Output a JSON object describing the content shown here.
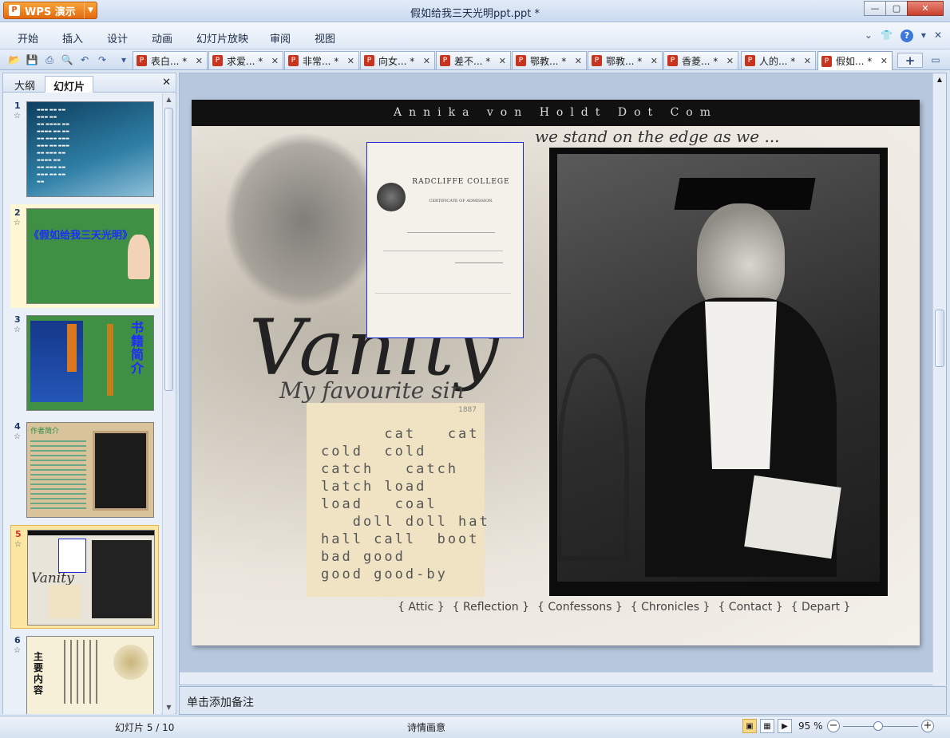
{
  "app": {
    "brand": "WPS 演示",
    "window_title": "假如给我三天光明ppt.ppt *"
  },
  "menu": {
    "items": [
      "开始",
      "插入",
      "设计",
      "动画",
      "幻灯片放映",
      "审阅",
      "视图"
    ]
  },
  "tabs": [
    {
      "label": "表白... *"
    },
    {
      "label": "求爱... *"
    },
    {
      "label": "非常... *"
    },
    {
      "label": "向女... *"
    },
    {
      "label": "差不... *"
    },
    {
      "label": "鄂教... *"
    },
    {
      "label": "鄂教... *"
    },
    {
      "label": "香菱... *"
    },
    {
      "label": "人的... *"
    },
    {
      "label": "假如... *"
    }
  ],
  "left_panel": {
    "tabs": [
      "大纲",
      "幻灯片"
    ],
    "active_tab": "幻灯片",
    "slides": [
      {
        "num": "1",
        "text": ""
      },
      {
        "num": "2",
        "text": "《假如给我三天光明》"
      },
      {
        "num": "3",
        "text": "书籍简介"
      },
      {
        "num": "4",
        "text": "作者简介"
      },
      {
        "num": "5",
        "text": ""
      },
      {
        "num": "6",
        "text": "主要内容"
      }
    ],
    "selected_slide": 5
  },
  "slide": {
    "site_header": "Annika von Holdt Dot Com",
    "tagline": "we stand on the edge as we ...",
    "title": "Vanity",
    "subtitle": "My favourite sin",
    "certificate_college": "RADCLIFFE COLLEGE",
    "certificate_sub": "CERTIFICATE OF ADMISSION.",
    "word_card_number": "1887",
    "word_card_lines": [
      "      cat   cat",
      "cold  cold",
      "catch   catch",
      "latch load",
      "load   coal",
      "   doll doll hat",
      "hall call  boot",
      "bad good",
      "good good-by"
    ],
    "nav_items": [
      "{ Attic }",
      "{ Reflection }",
      "{ Confessons }",
      "{ Chronicles }",
      "{ Contact }",
      "{ Depart }"
    ]
  },
  "notes": {
    "placeholder": "单击添加备注"
  },
  "status": {
    "slide_counter": "幻灯片 5 / 10",
    "theme": "诗情画意",
    "zoom": "95 %",
    "zoom_level_percent": 95
  }
}
